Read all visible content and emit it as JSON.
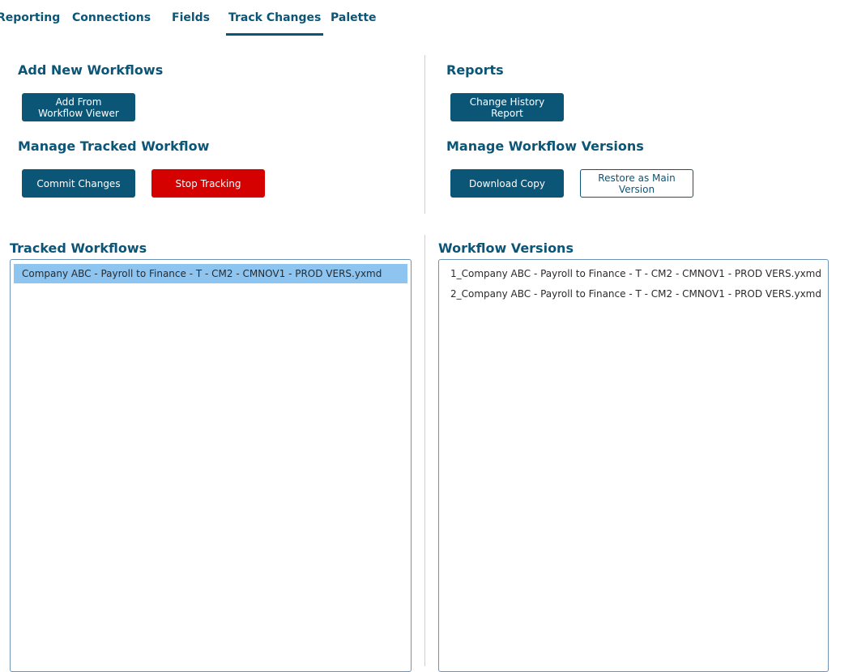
{
  "tabs": [
    {
      "label": "Reporting"
    },
    {
      "label": "Connections"
    },
    {
      "label": "Fields"
    },
    {
      "label": "Track Changes",
      "active": true
    },
    {
      "label": "Palette"
    }
  ],
  "left_panel": {
    "add_heading": "Add New Workflows",
    "add_button_line1": "Add From",
    "add_button_line2": "Workflow Viewer",
    "manage_heading": "Manage Tracked Workflow",
    "commit_button": "Commit Changes",
    "stop_button": "Stop Tracking"
  },
  "right_panel": {
    "reports_heading": "Reports",
    "report_button_line1": "Change History",
    "report_button_line2": "Report",
    "versions_heading": "Manage Workflow Versions",
    "download_button": "Download Copy",
    "restore_button_line1": "Restore as Main",
    "restore_button_line2": "Version"
  },
  "tracked_workflows": {
    "heading": "Tracked Workflows",
    "items": [
      {
        "label": "Company ABC - Payroll to Finance - T - CM2 - CMNOV1 - PROD VERS.yxmd",
        "selected": true
      }
    ]
  },
  "workflow_versions": {
    "heading": "Workflow Versions",
    "items": [
      {
        "label": "1_Company ABC - Payroll to Finance - T - CM2 - CMNOV1 - PROD VERS.yxmd"
      },
      {
        "label": "2_Company ABC - Payroll to Finance - T - CM2 - CMNOV1 - PROD VERS.yxmd"
      }
    ]
  },
  "colors": {
    "accent": "#0b5577",
    "danger": "#d50000",
    "selection": "#8ec4f0"
  }
}
